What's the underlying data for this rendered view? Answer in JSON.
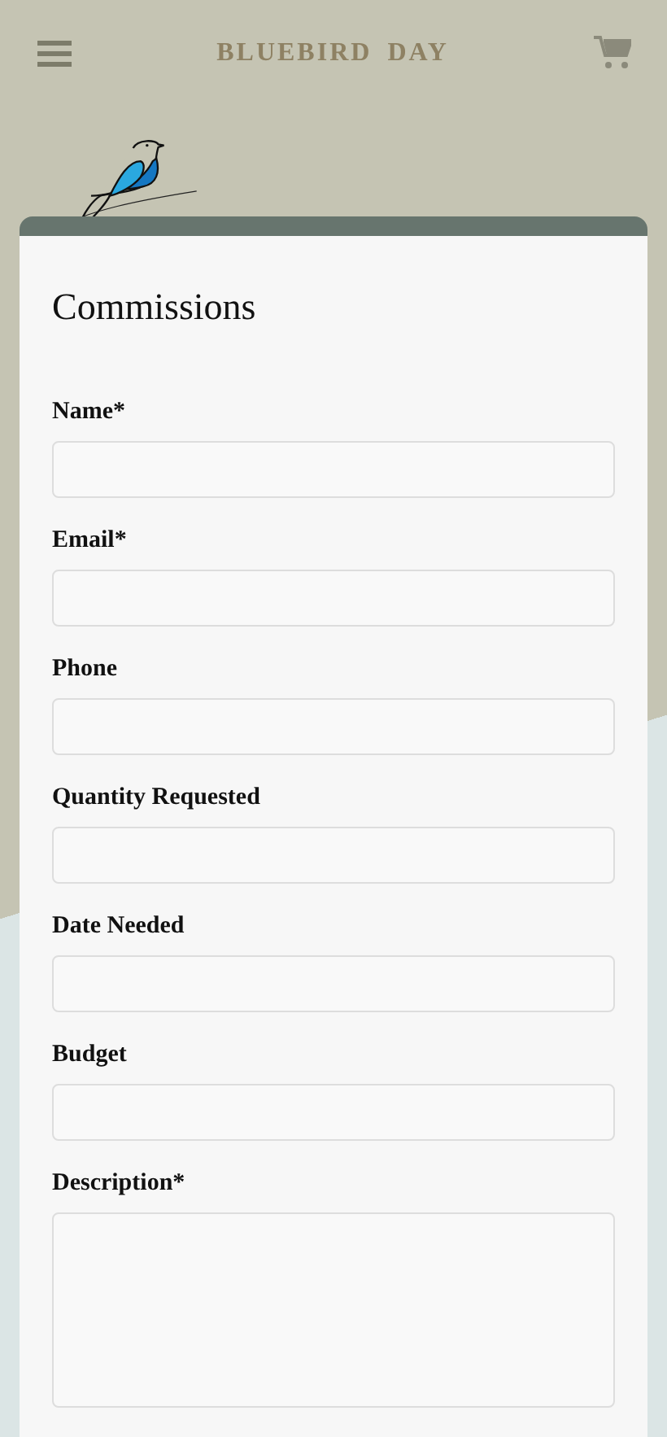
{
  "header": {
    "logo": "BLUEBIRD DAY"
  },
  "form": {
    "title": "Commissions",
    "fields": [
      {
        "label": "Name*",
        "kind": "input"
      },
      {
        "label": "Email*",
        "kind": "input"
      },
      {
        "label": "Phone",
        "kind": "input"
      },
      {
        "label": "Quantity Requested",
        "kind": "input"
      },
      {
        "label": "Date Needed",
        "kind": "input"
      },
      {
        "label": "Budget",
        "kind": "input"
      },
      {
        "label": "Description*",
        "kind": "textarea"
      }
    ]
  }
}
